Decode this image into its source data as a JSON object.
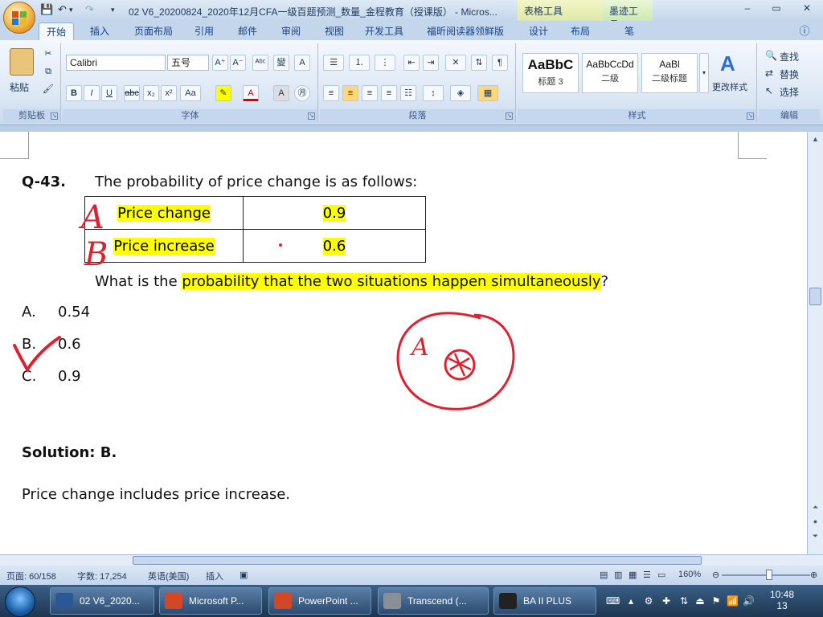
{
  "window": {
    "title": "02 V6_20200824_2020年12月CFA一级百题预测_数量_金程教育（授课版） - Micros...",
    "contextual_tabs": [
      "表格工具",
      "墨迹工具"
    ],
    "controls": {
      "minimize": "–",
      "maximize": "▭",
      "close": "✕"
    }
  },
  "ribbon_tabs": [
    "开始",
    "插入",
    "页面布局",
    "引用",
    "邮件",
    "审阅",
    "视图",
    "开发工具",
    "福昕阅读器领鲜版",
    "设计",
    "布局",
    "笔"
  ],
  "ribbon": {
    "clipboard": {
      "label": "剪贴板",
      "paste": "粘贴"
    },
    "font": {
      "label": "字体",
      "font_name": "Calibri",
      "font_size": "五号"
    },
    "paragraph": {
      "label": "段落"
    },
    "styles": {
      "label": "样式",
      "items": [
        {
          "sample": "AaBbC",
          "name": "标题 3"
        },
        {
          "sample": "AaBbCcDd",
          "name": "二级"
        },
        {
          "sample": "AaBl",
          "name": "二级标题"
        }
      ],
      "change_styles": "更改样式"
    },
    "editing": {
      "label": "编辑",
      "find": "查找",
      "replace": "替换",
      "select": "选择"
    }
  },
  "document": {
    "question_id": "Q-43.",
    "question_intro": "The probability of price change is as follows:",
    "table": [
      {
        "event": "Price change",
        "prob": "0.9"
      },
      {
        "event": "Price increase",
        "prob": "0.6"
      }
    ],
    "question_prefix": "What is the ",
    "question_highlight": "probability that the two situations happen simultaneously",
    "question_suffix": "?",
    "options": [
      {
        "letter": "A.",
        "value": "0.54"
      },
      {
        "letter": "B.",
        "value": "0.6"
      },
      {
        "letter": "C.",
        "value": "0.9"
      }
    ],
    "solution": "Solution: B.",
    "explanation": "Price change includes price increase.",
    "handwriting": {
      "row_a": "A",
      "row_b": "B",
      "circle_letter": "A"
    }
  },
  "statusbar": {
    "page": "页面: 60/158",
    "words": "字数: 17,254",
    "language": "英语(美国)",
    "mode": "插入",
    "zoom": "160%"
  },
  "taskbar": {
    "items": [
      {
        "label": "02 V6_2020...",
        "color": "#2b5797"
      },
      {
        "label": "Microsoft P...",
        "color": "#d24726"
      },
      {
        "label": "PowerPoint ...",
        "color": "#d24726"
      },
      {
        "label": "Transcend (...",
        "color": "#8a8f96"
      },
      {
        "label": "BA II PLUS",
        "color": "#222222"
      }
    ],
    "clock_time": "10:48",
    "clock_date": "13"
  }
}
